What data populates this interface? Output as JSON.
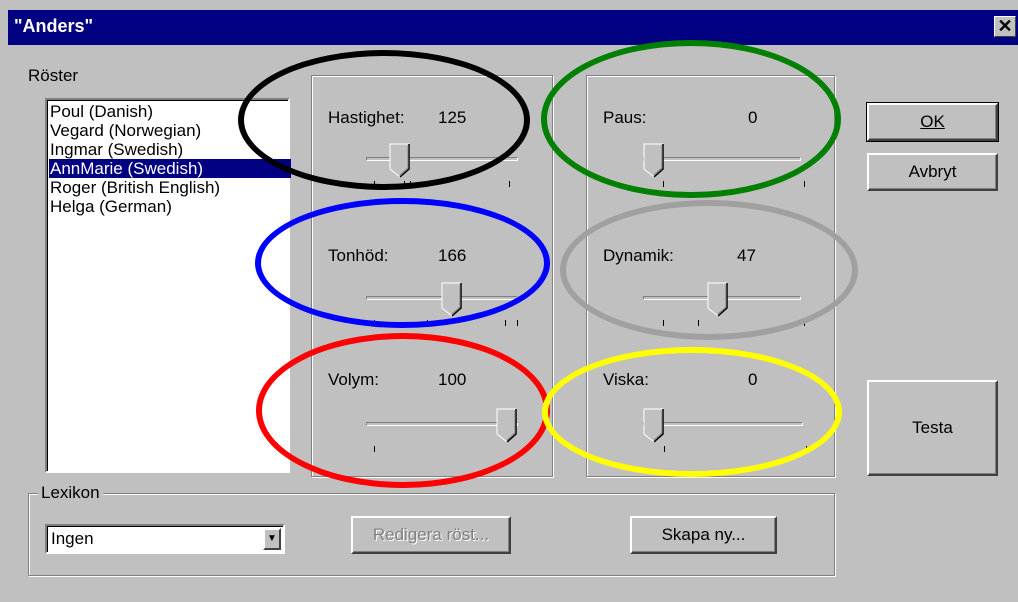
{
  "window": {
    "title": "\"Anders\"",
    "close": "✕"
  },
  "voices": {
    "group_label": "Röster",
    "items": [
      {
        "label": "Poul (Danish)"
      },
      {
        "label": "Vegard (Norwegian)"
      },
      {
        "label": "Ingmar (Swedish)"
      },
      {
        "label": "AnnMarie (Swedish)"
      },
      {
        "label": "Roger (British English)"
      },
      {
        "label": "Helga (German)"
      }
    ],
    "selected_index": 3
  },
  "sliders": {
    "speed": {
      "label": "Hastighet:",
      "value": "125",
      "position": 0.18
    },
    "pitch": {
      "label": "Tonhöd:",
      "value": "166",
      "position": 0.58
    },
    "volume": {
      "label": "Volym:",
      "value": "100",
      "position": 1.0
    },
    "pause": {
      "label": "Paus:",
      "value": "0",
      "position": 0.0
    },
    "dynamic": {
      "label": "Dynamik:",
      "value": "47",
      "position": 0.47
    },
    "whisper": {
      "label": "Viska:",
      "value": "0",
      "position": 0.0
    }
  },
  "buttons": {
    "ok": "OK",
    "cancel": "Avbryt",
    "test": "Testa",
    "edit_voice": "Redigera röst...",
    "create_new": "Skapa ny..."
  },
  "lexicon": {
    "group_label": "Lexikon",
    "selected": "Ingen"
  },
  "annotation_colors": {
    "speed": "#000000",
    "pitch": "#0000ff",
    "volume": "#ff0000",
    "pause": "#008000",
    "dynamic": "#a0a0a0",
    "whisper": "#ffff00"
  }
}
